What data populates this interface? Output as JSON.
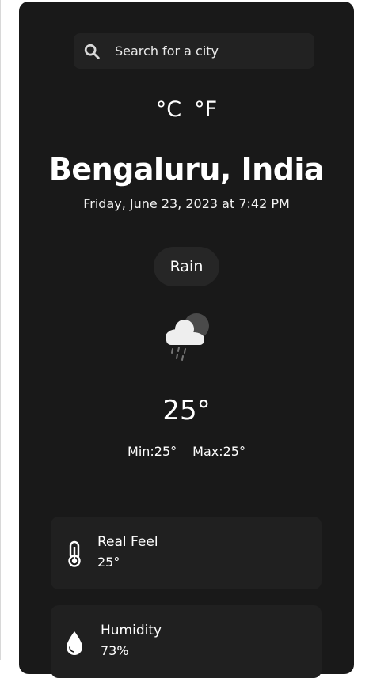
{
  "search": {
    "placeholder": "Search for a city"
  },
  "units": {
    "celsius": "°C",
    "fahrenheit": "°F"
  },
  "location": {
    "city": "Bengaluru, India",
    "datetime": "Friday, June 23, 2023 at 7:42 PM"
  },
  "weather": {
    "condition": "Rain",
    "icon": "rain-cloud-moon-icon",
    "temperature": "25°",
    "min": "Min:25°",
    "max": "Max:25°"
  },
  "stats": {
    "real_feel": {
      "label": "Real Feel",
      "value": "25°",
      "icon": "thermometer-icon"
    },
    "humidity": {
      "label": "Humidity",
      "value": "73%",
      "icon": "water-drop-icon"
    }
  },
  "colors": {
    "background": "#191919",
    "panel": "#202020",
    "text": "#ffffff"
  }
}
